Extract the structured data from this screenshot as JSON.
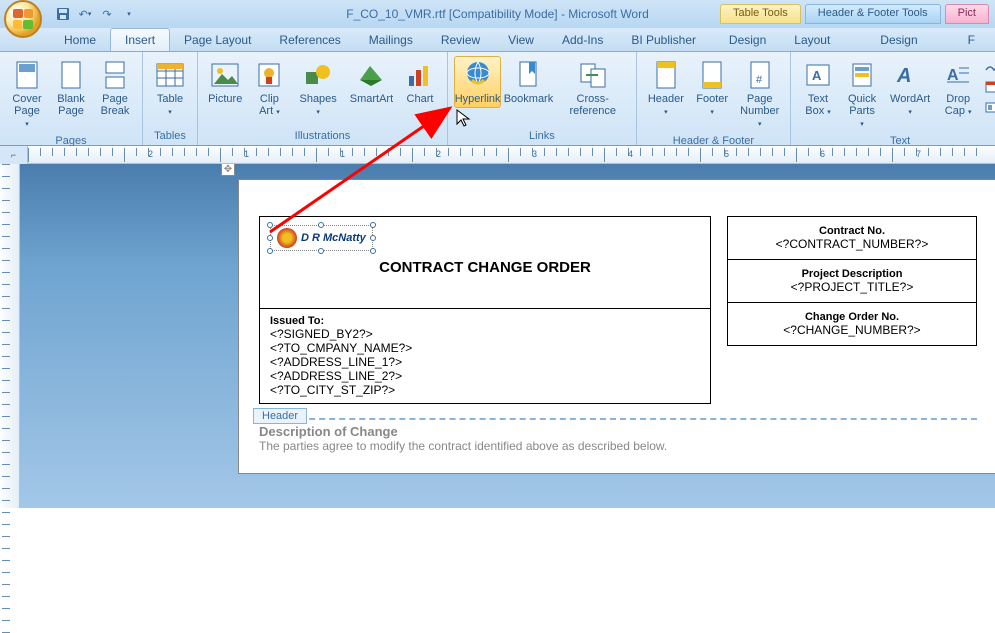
{
  "title": "F_CO_10_VMR.rtf [Compatibility Mode] - Microsoft Word",
  "context_groups": {
    "table": "Table Tools",
    "hf": "Header & Footer Tools",
    "pic": "Pict"
  },
  "tabs": {
    "home": "Home",
    "insert": "Insert",
    "page_layout": "Page Layout",
    "references": "References",
    "mailings": "Mailings",
    "review": "Review",
    "view": "View",
    "addins": "Add-Ins",
    "bipub": "BI Publisher",
    "design": "Design",
    "layout": "Layout",
    "design2": "Design",
    "format": "F"
  },
  "ribbon": {
    "pages": {
      "label": "Pages",
      "cover": "Cover\nPage",
      "blank": "Blank\nPage",
      "break": "Page\nBreak"
    },
    "tables": {
      "label": "Tables",
      "table": "Table"
    },
    "illus": {
      "label": "Illustrations",
      "picture": "Picture",
      "clip": "Clip\nArt",
      "shapes": "Shapes",
      "smartart": "SmartArt",
      "chart": "Chart"
    },
    "links": {
      "label": "Links",
      "hyperlink": "Hyperlink",
      "bookmark": "Bookmark",
      "crossref": "Cross-reference"
    },
    "hf": {
      "label": "Header & Footer",
      "header": "Header",
      "footer": "Footer",
      "pagenum": "Page\nNumber"
    },
    "text": {
      "label": "Text",
      "textbox": "Text\nBox",
      "quickparts": "Quick\nParts",
      "wordart": "WordArt",
      "dropcap": "Drop\nCap"
    }
  },
  "ruler": {
    "nums": [
      "2",
      "1",
      "1",
      "2",
      "3",
      "4",
      "5",
      "6",
      "7"
    ]
  },
  "doc": {
    "logo_text": "D R McNatty",
    "main_title": "CONTRACT CHANGE ORDER",
    "issued_label": "Issued To:",
    "issued_lines": [
      "<?SIGNED_BY2?>",
      "<?TO_CMPANY_NAME?>",
      "<?ADDRESS_LINE_1?>",
      "<?ADDRESS_LINE_2?>",
      "<?TO_CITY_ST_ZIP?>"
    ],
    "right": {
      "contract_label": "Contract No.",
      "contract_val": "<?CONTRACT_NUMBER?>",
      "proj_label": "Project Description",
      "proj_val": "<?PROJECT_TITLE?>",
      "change_label": "Change Order No.",
      "change_val": "<?CHANGE_NUMBER?>"
    },
    "header_tag": "Header",
    "desc_title": "Description of Change",
    "desc_body": "The parties agree to modify the contract identified above as described below."
  }
}
